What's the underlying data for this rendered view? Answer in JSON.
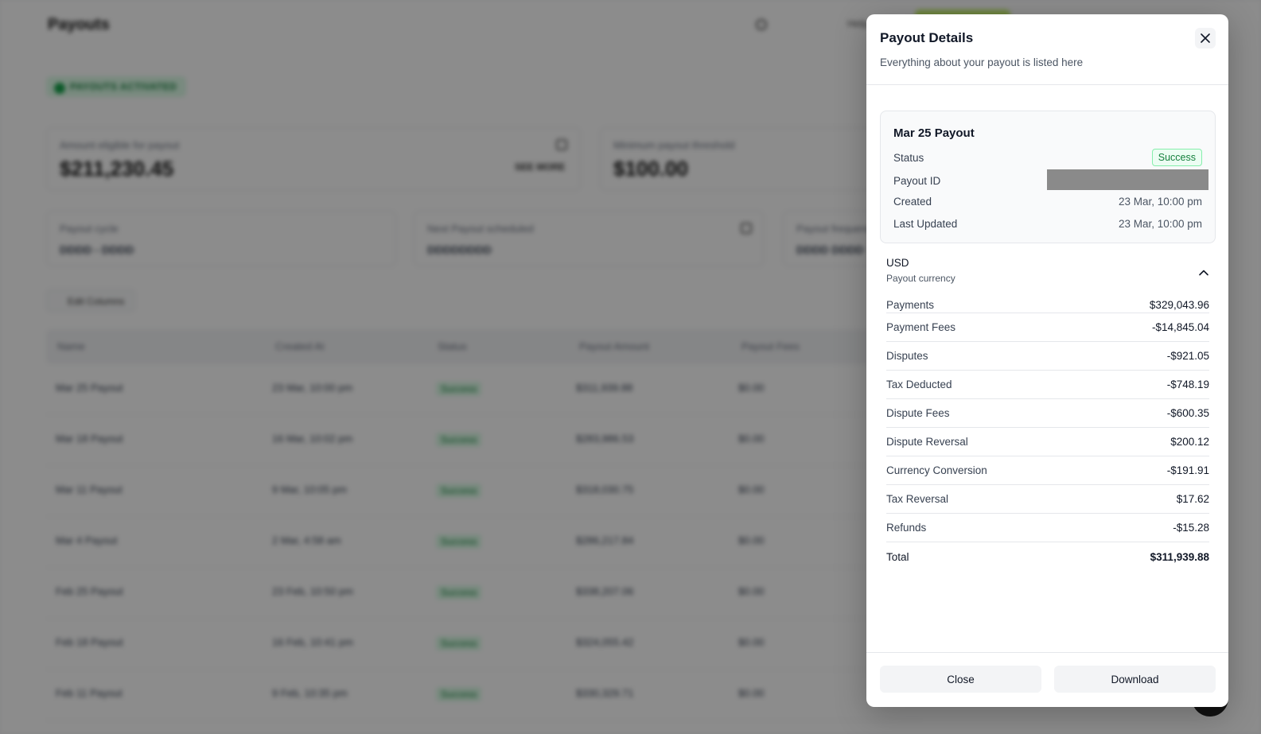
{
  "background": {
    "page_title": "Payouts",
    "help_label": "Help",
    "badge": "PAYOUTS ACTIVATED",
    "cards_top": [
      {
        "label": "Amount eligible for payout",
        "value": "$211,230.45",
        "link": "SEE MORE"
      },
      {
        "label": "Minimum payout threshold",
        "value": "$100.00"
      }
    ],
    "cards_mid": [
      {
        "label": "Payout cycle",
        "value": "DDDD - DDDD"
      },
      {
        "label": "Next Payout scheduled",
        "value": "DDDDDDDD"
      },
      {
        "label": "Payout frequency",
        "value": "DDDD DDDD"
      }
    ],
    "edit_columns": "Edit Columns",
    "table_headers": [
      "Name",
      "Created At",
      "Status",
      "Payout Amount",
      "Payout Fees"
    ],
    "table_rows": [
      [
        "Mar 25 Payout",
        "23 Mar, 10:00 pm",
        "Success",
        "$311,939.88",
        "$0.00"
      ],
      [
        "Mar 18 Payout",
        "16 Mar, 10:02 pm",
        "Success",
        "$283,986.53",
        "$0.00"
      ],
      [
        "Mar 11 Payout",
        "9 Mar, 10:05 pm",
        "Success",
        "$318,030.75",
        "$0.00"
      ],
      [
        "Mar 4 Payout",
        "2 Mar, 4:58 am",
        "Success",
        "$286,217.84",
        "$0.00"
      ],
      [
        "Feb 25 Payout",
        "23 Feb, 10:50 pm",
        "Success",
        "$338,207.06",
        "$0.00"
      ],
      [
        "Feb 18 Payout",
        "16 Feb, 10:41 pm",
        "Success",
        "$324,055.42",
        "$0.00"
      ],
      [
        "Feb 11 Payout",
        "9 Feb, 10:35 pm",
        "Success",
        "$330,329.71",
        "$0.00"
      ]
    ]
  },
  "drawer": {
    "title": "Payout Details",
    "subtitle": "Everything about your payout is listed here",
    "summary": {
      "title": "Mar 25 Payout",
      "status_label": "Status",
      "status_value": "Success",
      "payout_id_label": "Payout ID",
      "created_label": "Created",
      "created_value": "23 Mar, 10:00 pm",
      "updated_label": "Last Updated",
      "updated_value": "23 Mar, 10:00 pm"
    },
    "currency": {
      "code": "USD",
      "label": "Payout currency"
    },
    "breakdown": [
      {
        "label": "Payments",
        "value": "$329,043.96"
      },
      {
        "label": "Payment Fees",
        "value": "-$14,845.04"
      },
      {
        "label": "Disputes",
        "value": "-$921.05"
      },
      {
        "label": "Tax Deducted",
        "value": "-$748.19"
      },
      {
        "label": "Dispute Fees",
        "value": "-$600.35"
      },
      {
        "label": "Dispute Reversal",
        "value": "$200.12"
      },
      {
        "label": "Currency Conversion",
        "value": "-$191.91"
      },
      {
        "label": "Tax Reversal",
        "value": "$17.62"
      },
      {
        "label": "Refunds",
        "value": "-$15.28"
      },
      {
        "label": "Total",
        "value": "$311,939.88"
      }
    ],
    "close_label": "Close",
    "download_label": "Download"
  }
}
